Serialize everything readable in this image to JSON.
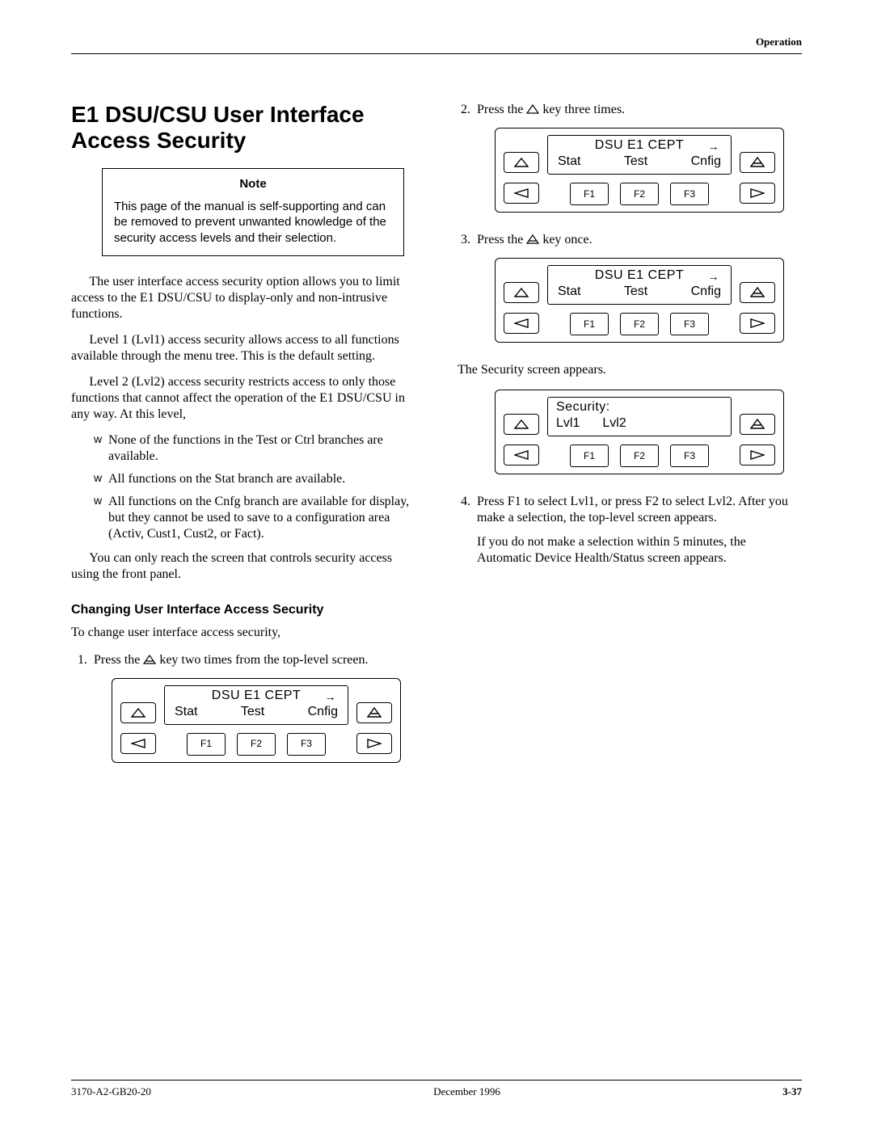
{
  "header": {
    "section": "Operation"
  },
  "title": "E1 DSU/CSU User Interface Access Security",
  "note": {
    "title": "Note",
    "body": "This page of the manual is self-supporting and can be removed to prevent unwanted knowledge of the security access levels and their selection."
  },
  "paras": {
    "p1": "The user interface access security option allows you to limit access to the E1 DSU/CSU to display-only and non-intrusive functions.",
    "p2": "Level 1 (Lvl1) access security allows access to all functions available through the menu tree. This is the default setting.",
    "p3": "Level 2 (Lvl2) access security restricts access to only those functions that cannot affect the operation of the E1 DSU/CSU in any way. At this level,",
    "p4": "You can only reach the screen that controls security access using the front panel."
  },
  "bullets": {
    "b1": "None of the functions in the Test or Ctrl branches are available.",
    "b2": "All functions on the Stat branch are available.",
    "b3": "All functions on the Cnfg branch are available for display, but they cannot be used to save to a configuration area (Activ, Cust1, Cust2, or Fact)."
  },
  "subheading": "Changing User Interface Access Security",
  "intro2": "To change user interface access security,",
  "steps": {
    "s1a": "Press the ",
    "s1b": " key two times from the top-level screen.",
    "s2a": "Press the ",
    "s2b": " key three times.",
    "s3a": "Press the ",
    "s3b": " key once.",
    "s3after": "The Security screen appears.",
    "s4": "Press F1 to select Lvl1, or press F2 to select Lvl2. After you make a selection, the top-level screen appears.",
    "s4extra": "If you do not make a selection within 5 minutes, the Automatic Device Health/Status screen appears."
  },
  "panel": {
    "title": "DSU E1 CEPT",
    "menu": {
      "m1": "Stat",
      "m2": "Test",
      "m3": "Cnfig"
    },
    "fkeys": {
      "f1": "F1",
      "f2": "F2",
      "f3": "F3"
    },
    "security_title": "Security:",
    "security": {
      "l1": "Lvl1",
      "l2": "Lvl2"
    }
  },
  "footer": {
    "doc": "3170-A2-GB20-20",
    "date": "December 1996",
    "page": "3-37"
  }
}
